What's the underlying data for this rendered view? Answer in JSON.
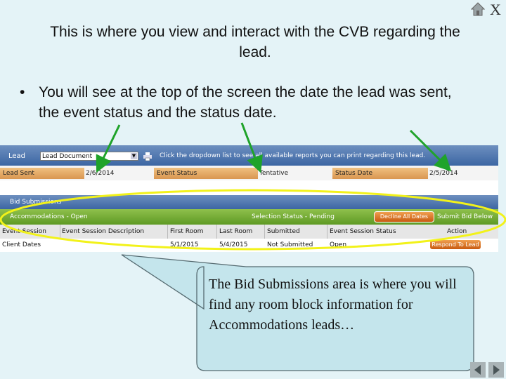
{
  "slide": {
    "title": "This is where you view and interact with the CVB regarding the lead.",
    "bullet_dot": "•",
    "bullet_text": "You will see at the top of the screen the date the lead was sent, the event status and the status date.",
    "close_label": "X",
    "callout_text": "The Bid Submissions area is where you will find any room block information for Accommodations leads…"
  },
  "app": {
    "lead_label": "Lead",
    "lead_select_value": "Lead Document",
    "dropdown_hint": "Click the dropdown list to see all available reports you can print regarding this lead.",
    "lead_sent_label": "Lead Sent",
    "lead_sent_value": "2/6/2014",
    "event_status_label": "Event Status",
    "event_status_value": "Tentative",
    "status_date_label": "Status Date",
    "status_date_value": "2/5/2014",
    "bid_submissions_label": "Bid Submissions",
    "accommodations_label": "Accommodations -  Open",
    "selection_status_label": "Selection Status -  Pending",
    "decline_button": "Decline All Dates",
    "submit_button": "Submit Bid Below",
    "columns": [
      "Event Session",
      "Event Session Description",
      "First Room",
      "Last Room",
      "Submitted",
      "Event Session Status",
      "Action"
    ],
    "row": {
      "event_session": "Client Dates",
      "description": "",
      "first_room": "5/1/2015",
      "last_room": "5/4/2015",
      "submitted": "Not Submitted",
      "status": "Open",
      "action": "Respond To Lead"
    }
  },
  "colors": {
    "slide_bg": "#e4f3f7",
    "arrow_green": "#1fa32a",
    "highlight_yellow": "#f2f21a",
    "callout_fill": "#c4e5ec",
    "callout_border": "#556a70"
  },
  "icons": [
    "home-icon",
    "print-icon",
    "chevron-down-icon",
    "nav-prev-icon",
    "nav-next-icon"
  ]
}
